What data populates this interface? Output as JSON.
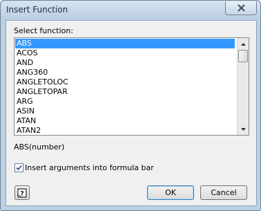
{
  "window": {
    "title": "Insert Function"
  },
  "dialog": {
    "select_label": "Select function:",
    "functions": [
      "ABS",
      "ACOS",
      "AND",
      "ANG360",
      "ANGLETOLOC",
      "ANGLETOPAR",
      "ARG",
      "ASIN",
      "ATAN",
      "ATAN2"
    ],
    "selected_index": 0,
    "signature": "ABS(number)",
    "checkbox_label": "Insert arguments into formula bar",
    "checkbox_checked": true,
    "ok_label": "OK",
    "cancel_label": "Cancel"
  },
  "icons": {
    "close": "close-icon",
    "help": "help-icon",
    "scroll_up": "arrow-up-icon",
    "scroll_down": "arrow-down-icon",
    "check": "checkmark-icon"
  },
  "colors": {
    "selection": "#3399ff",
    "window_frame": "#bcd0e6",
    "dialog_bg": "#f0f0f0"
  }
}
